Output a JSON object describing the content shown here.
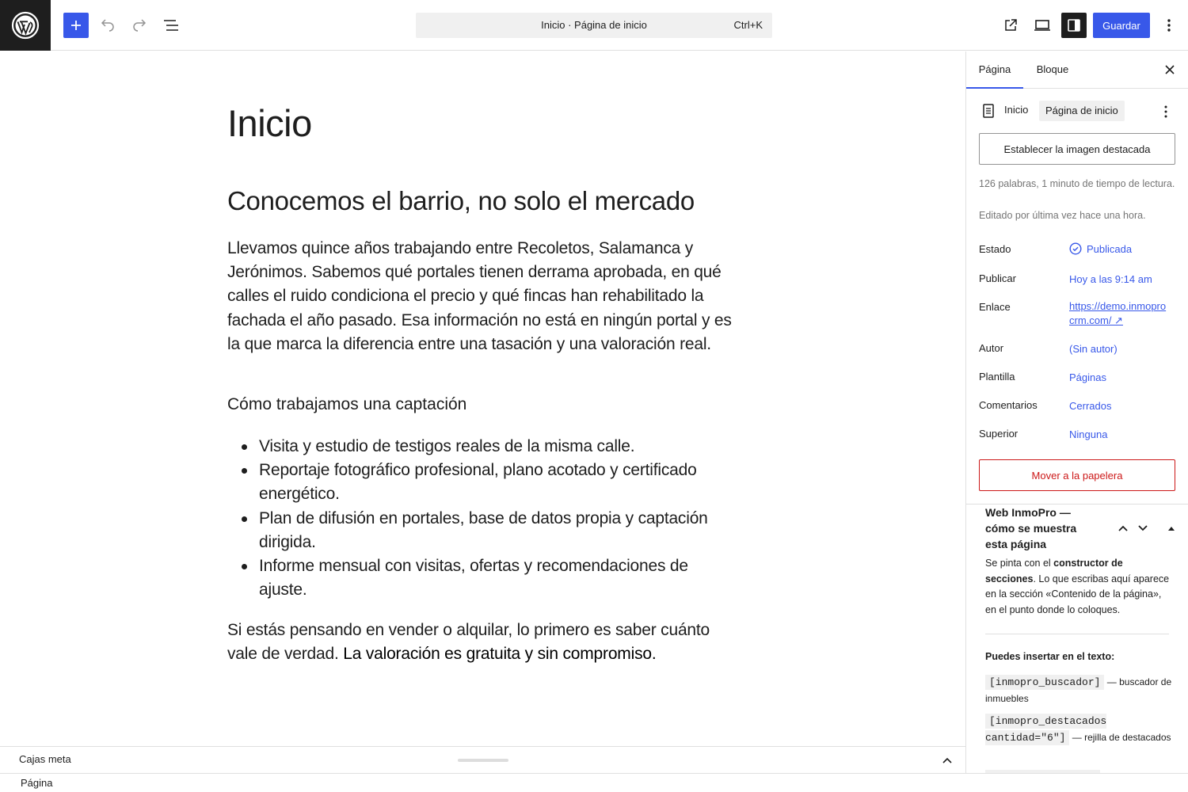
{
  "topbar": {
    "doc_title": "Inicio · Página de inicio",
    "shortcut": "Ctrl+K",
    "save_label": "Guardar"
  },
  "editor": {
    "title": "Inicio",
    "heading": "Conocemos el barrio, no solo el mercado",
    "paragraph1": "Llevamos quince años trabajando entre Recoletos, Salamanca y Jerónimos. Sabemos qué portales tienen derrama aprobada, en qué calles el ruido condiciona el precio y qué fincas han rehabilitado la fachada el año pasado. Esa información no está en ningún portal y es la que marca la diferencia entre una tasación y una valoración real.",
    "subheading": "Cómo trabajamos una captación",
    "list": [
      "Visita y estudio de testigos reales de la misma calle.",
      "Reportaje fotográfico profesional, plano acotado y certificado energético.",
      "Plan de difusión en portales, base de datos propia y captación dirigida.",
      "Informe mensual con visitas, ofertas y recomendaciones de ajuste."
    ],
    "paragraph2_start": "Si estás pensando en vender o alquilar, lo primero es saber cuánto vale de verdad. ",
    "paragraph2_strong": "La valoración es gratuita y sin compromiso."
  },
  "metabox_bar": {
    "label": "Cajas meta"
  },
  "footer": {
    "breadcrumb": "Página"
  },
  "sidebar": {
    "tabs": [
      "Página",
      "Bloque"
    ],
    "page_name": "Inicio",
    "page_tag": "Página de inicio",
    "featured_image": "Establecer la imagen destacada",
    "stats": "126 palabras, 1 minuto de tiempo de lectura.",
    "edited": "Editado por última vez hace una hora.",
    "rows": [
      {
        "label": "Estado",
        "value": "Publicada"
      },
      {
        "label": "Publicar",
        "value": "Hoy a las 9:14 am"
      },
      {
        "label": "Enlace",
        "value": "https://demo.inmoprocrm.com/ ↗"
      },
      {
        "label": "Autor",
        "value": "(Sin autor)"
      },
      {
        "label": "Plantilla",
        "value": "Páginas"
      },
      {
        "label": "Comentarios",
        "value": "Cerrados"
      },
      {
        "label": "Superior",
        "value": "Ninguna"
      }
    ],
    "trash": "Mover a la papelera",
    "metabox": {
      "title": "Web InmoPro — cómo se muestra esta página",
      "desc_a": "Se pinta con el ",
      "desc_b": "constructor de secciones",
      "desc_c": ". Lo que escribas aquí aparece en la sección «Contenido de la página», en el punto donde lo coloques.",
      "insert_label": "Puedes insertar en el texto:",
      "shortcodes": [
        {
          "code": "[inmopro_buscador]",
          "desc": " — buscador de inmuebles"
        },
        {
          "code": "[inmopro_destacados cantidad=\"6\"]",
          "desc": " — rejilla de destacados"
        }
      ]
    }
  },
  "colors": {
    "accent": "#3858e9",
    "danger": "#cc1818",
    "dark": "#1e1e1e"
  }
}
